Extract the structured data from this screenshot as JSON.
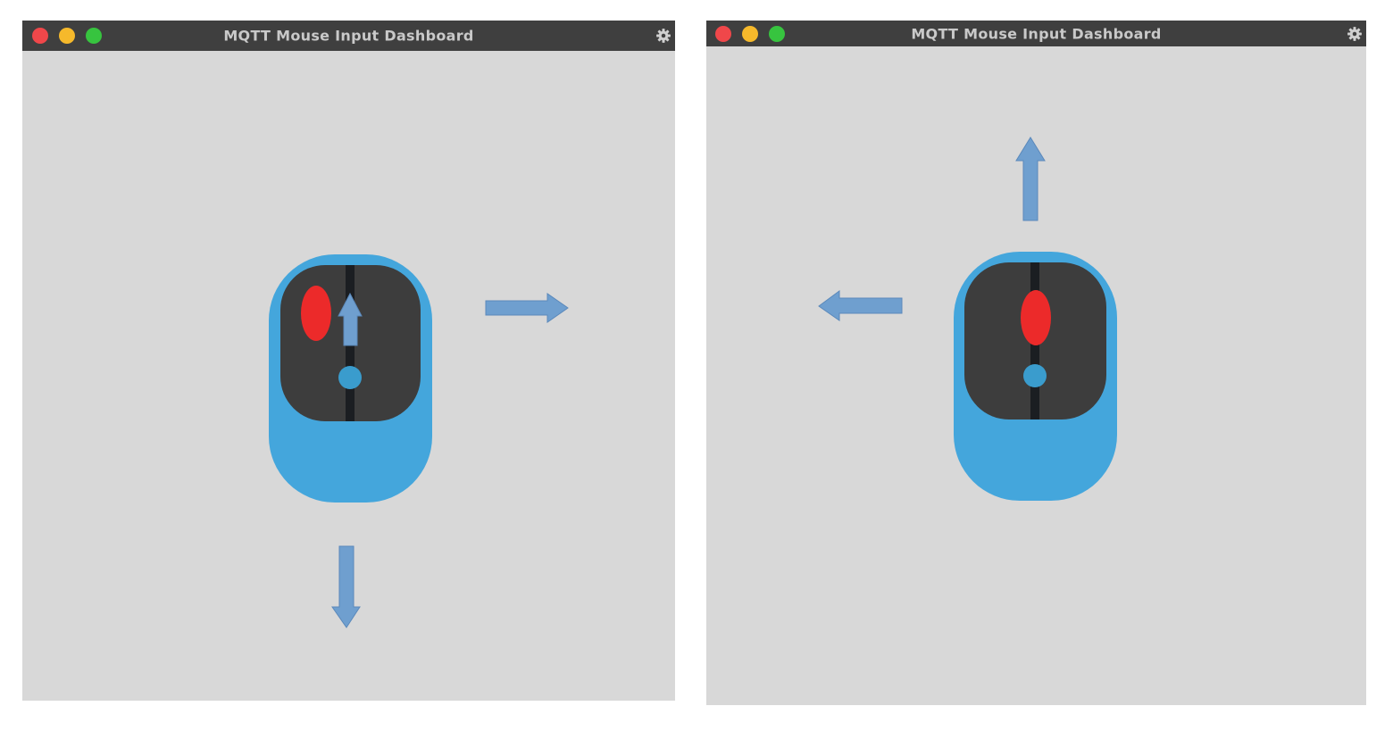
{
  "windows": [
    {
      "title": "MQTT Mouse Input Dashboard",
      "active_button": "left",
      "scroll_direction": "up",
      "movement_direction": "down-right"
    },
    {
      "title": "MQTT Mouse Input Dashboard",
      "active_button": "middle",
      "scroll_direction": "none",
      "movement_direction": "up-left"
    }
  ],
  "icons": {
    "window_controls": [
      "close",
      "minimize",
      "maximize"
    ],
    "settings": "gear-icon"
  },
  "colors": {
    "titlebar": "#3f3f3f",
    "title_text": "#c9c9c9",
    "window_bg": "#d8d8d8",
    "mouse_body": "#44a6dc",
    "mouse_top": "#3d3d3d",
    "mouse_divider": "#1b1e22",
    "active_button": "#ec2a2a",
    "scroll_wheel": "#3a9ccd",
    "arrow": "#6f9fcf",
    "arrow_stroke": "#5b89bb",
    "close": "#f0474a",
    "minimize": "#f6b92b",
    "maximize": "#37c43f"
  }
}
